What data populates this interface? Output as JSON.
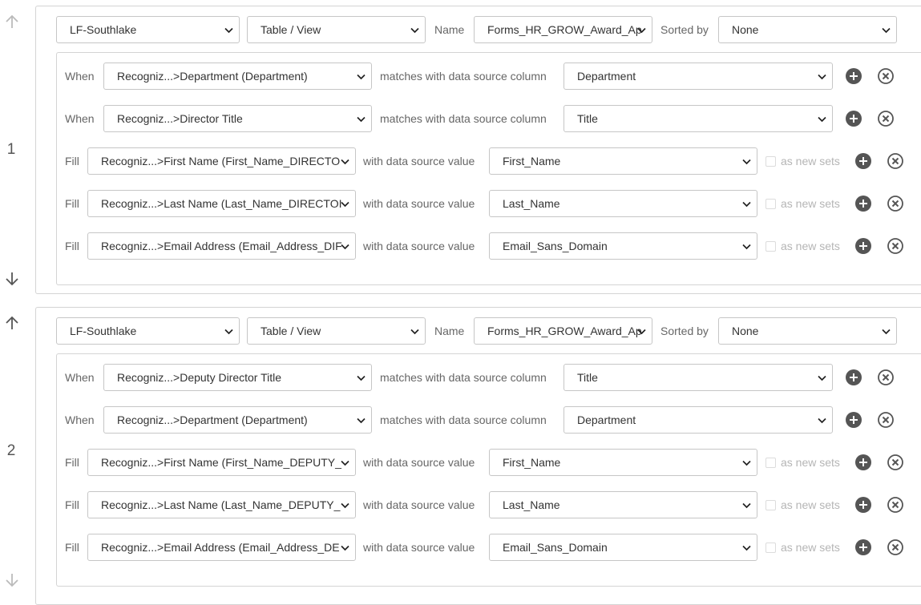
{
  "lookups": [
    {
      "index": "1",
      "repository": "LF-Southlake",
      "source_type": "Table / View",
      "name_label": "Name",
      "name_value": "Forms_HR_GROW_Award_Ap",
      "sorted_label": "Sorted by",
      "sorted_value": "None",
      "when_rows": [
        {
          "label": "When",
          "field": "Recogniz...>Department (Department)",
          "connector": "matches with data source column",
          "column": "Department"
        },
        {
          "label": "When",
          "field": "Recogniz...>Director Title",
          "connector": "matches with data source column",
          "column": "Title"
        }
      ],
      "fill_rows": [
        {
          "label": "Fill",
          "field": "Recogniz...>First Name (First_Name_DIRECTO",
          "connector": "with data source value",
          "value": "First_Name",
          "checkbox_label": "as new sets"
        },
        {
          "label": "Fill",
          "field": "Recogniz...>Last Name (Last_Name_DIRECTOI",
          "connector": "with data source value",
          "value": "Last_Name",
          "checkbox_label": "as new sets"
        },
        {
          "label": "Fill",
          "field": "Recogniz...>Email Address (Email_Address_DIF",
          "connector": "with data source value",
          "value": "Email_Sans_Domain",
          "checkbox_label": "as new sets"
        }
      ]
    },
    {
      "index": "2",
      "repository": "LF-Southlake",
      "source_type": "Table / View",
      "name_label": "Name",
      "name_value": "Forms_HR_GROW_Award_Ap",
      "sorted_label": "Sorted by",
      "sorted_value": "None",
      "when_rows": [
        {
          "label": "When",
          "field": "Recogniz...>Deputy Director Title",
          "connector": "matches with data source column",
          "column": "Title"
        },
        {
          "label": "When",
          "field": "Recogniz...>Department (Department)",
          "connector": "matches with data source column",
          "column": "Department"
        }
      ],
      "fill_rows": [
        {
          "label": "Fill",
          "field": "Recogniz...>First Name (First_Name_DEPUTY_",
          "connector": "with data source value",
          "value": "First_Name",
          "checkbox_label": "as new sets"
        },
        {
          "label": "Fill",
          "field": "Recogniz...>Last Name (Last_Name_DEPUTY_",
          "connector": "with data source value",
          "value": "Last_Name",
          "checkbox_label": "as new sets"
        },
        {
          "label": "Fill",
          "field": "Recogniz...>Email Address (Email_Address_DE",
          "connector": "with data source value",
          "value": "Email_Sans_Domain",
          "checkbox_label": "as new sets"
        }
      ]
    }
  ],
  "colors": {
    "icon_dark": "#555555",
    "arrow_active": "#555555",
    "arrow_disabled": "#bbbbbb",
    "border": "#d4d4d4"
  }
}
